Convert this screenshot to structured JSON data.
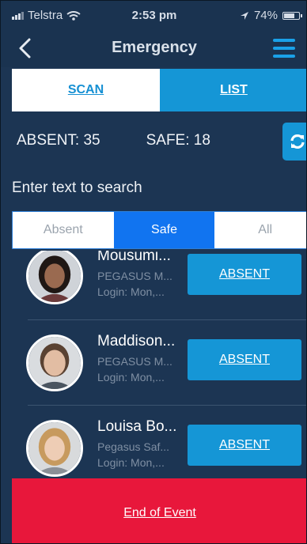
{
  "status_bar": {
    "carrier": "Telstra",
    "time": "2:53 pm",
    "battery": "74%",
    "battery_level": 0.74
  },
  "nav": {
    "title": "Emergency",
    "back_icon": "chevron-left-icon",
    "menu_icon": "hamburger-menu-icon"
  },
  "mode_tabs": {
    "scan_label": "SCAN",
    "list_label": "LIST",
    "selected": "LIST"
  },
  "counts": {
    "absent": "ABSENT: 35",
    "safe": "SAFE: 18"
  },
  "search": {
    "placeholder": "Enter text to search"
  },
  "filter": {
    "absent_label": "Absent",
    "safe_label": "Safe",
    "all_label": "All",
    "selected": "Safe"
  },
  "people": [
    {
      "name": "Mousumi...",
      "org": "PEGASUS M...",
      "login": "Login: Mon,...",
      "action": "ABSENT"
    },
    {
      "name": "Maddison...",
      "org": "PEGASUS M...",
      "login": "Login: Mon,...",
      "action": "ABSENT"
    },
    {
      "name": "Louisa Bo...",
      "org": "Pegasus Saf...",
      "login": "Login: Mon,...",
      "action": "ABSENT"
    }
  ],
  "footer": {
    "end_label": "End of Event"
  },
  "colors": {
    "background": "#1c3553",
    "accent": "#1596d6",
    "selected_filter": "#1174f0",
    "danger": "#e8173b"
  }
}
